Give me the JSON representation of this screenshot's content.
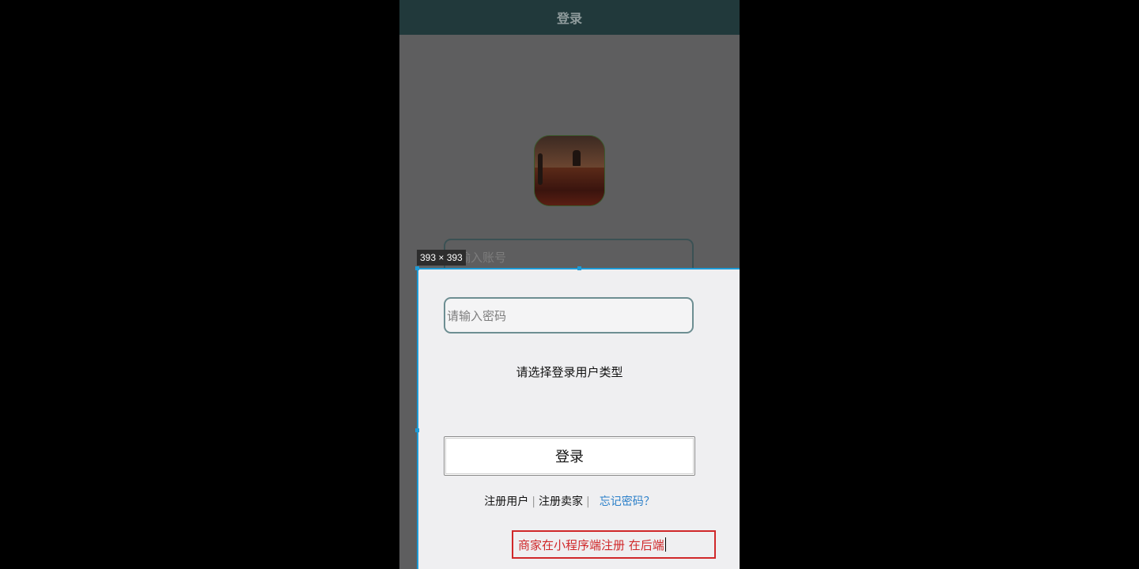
{
  "navbar": {
    "title": "登录"
  },
  "login": {
    "account_placeholder": "请输入账号",
    "password_placeholder": "请输入密码",
    "user_type_prompt": "请选择登录用户类型",
    "login_label": "登录",
    "register_user_label": "注册用户",
    "register_seller_label": "注册卖家",
    "forgot_password_label": "忘记密码？",
    "separator": "|"
  },
  "devtools": {
    "size_badge": "393 × 393"
  },
  "annotation": {
    "text": "商家在小程序端注册 在后端"
  },
  "colors": {
    "navbar": "#21393b",
    "backdrop": "#5e5e5f",
    "panel": "#efeff1",
    "selection": "#1e9bd7",
    "link": "#2a7fc9",
    "annotation": "#d0282a"
  },
  "icons": {
    "logo": "app-logo-image"
  }
}
